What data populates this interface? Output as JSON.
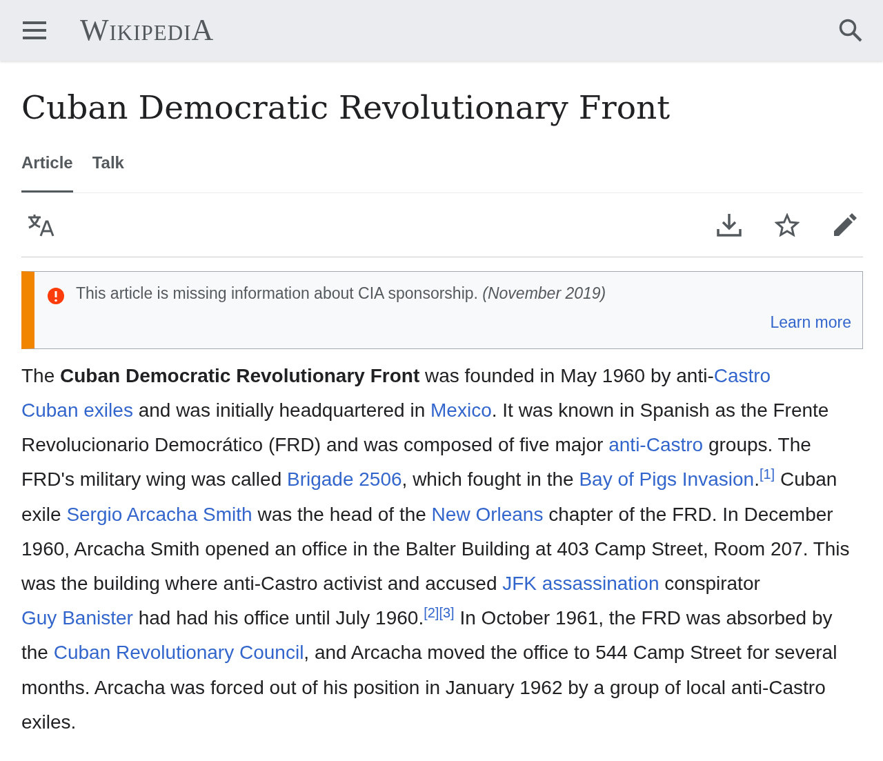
{
  "header": {
    "logo": "WikipediA"
  },
  "title": "Cuban Democratic Revolutionary Front",
  "tabs": [
    {
      "label": "Article",
      "selected": true
    },
    {
      "label": "Talk",
      "selected": false
    }
  ],
  "notice": {
    "text": "This article is missing information about CIA sponsorship. *(November 2019)*",
    "link": "Learn more"
  },
  "paragraph": [
    {
      "kind": "text",
      "text": "The "
    },
    {
      "kind": "bold",
      "text": "Cuban Democratic Revolutionary Front"
    },
    {
      "kind": "text",
      "text": " was founded in May 1960 by anti-"
    },
    {
      "kind": "link",
      "text": "Castro"
    },
    {
      "kind": "link",
      "text": "Cuban exiles",
      "space_before": true
    },
    {
      "kind": "text",
      "text": " and was initially headquartered in "
    },
    {
      "kind": "link",
      "text": "Mexico"
    },
    {
      "kind": "text",
      "text": ". It was known in Spanish as the Frente Revolucionario Democrático (FRD) and was composed of five major "
    },
    {
      "kind": "link",
      "text": "anti-Castro"
    },
    {
      "kind": "text",
      "text": " groups. The FRD's military wing was called "
    },
    {
      "kind": "link",
      "text": "Brigade 2506"
    },
    {
      "kind": "text",
      "text": ", which fought in the "
    },
    {
      "kind": "link",
      "text": "Bay of Pigs"
    },
    {
      "kind": "link",
      "text": "Invasion",
      "space_before": true
    },
    {
      "kind": "text",
      "text": "."
    },
    {
      "kind": "ref",
      "text": "[1]"
    },
    {
      "kind": "text",
      "text": " Cuban exile "
    },
    {
      "kind": "link",
      "text": "Sergio Arcacha Smith"
    },
    {
      "kind": "text",
      "text": " was the head of the "
    },
    {
      "kind": "link",
      "text": "New Orleans"
    },
    {
      "kind": "text",
      "text": " chapter of the FRD. In December 1960, Arcacha Smith opened an office in the Balter Building at 403 Camp Street, Room 207. This was the building where anti-Castro activist and accused "
    },
    {
      "kind": "link",
      "text": "JFK assassination"
    },
    {
      "kind": "text",
      "text": " conspirator "
    },
    {
      "kind": "link",
      "text": "Guy Banister"
    },
    {
      "kind": "text",
      "text": " had had his office until July 1960."
    },
    {
      "kind": "ref",
      "text": "[2]"
    },
    {
      "kind": "ref",
      "text": "[3]"
    },
    {
      "kind": "text",
      "text": " In October 1961, the FRD was absorbed by the "
    },
    {
      "kind": "link",
      "text": "Cuban Revolutionary Council"
    },
    {
      "kind": "text",
      "text": ", and Arcacha moved the office to 544 Camp Street for several months. Arcacha was forced out of his position in January 1962 by a group of local anti-Castro exiles."
    }
  ]
}
